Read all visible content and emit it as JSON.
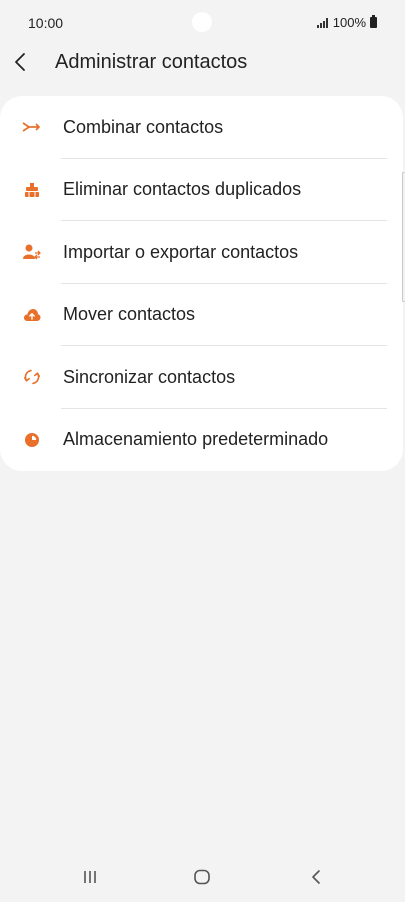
{
  "status_bar": {
    "time": "10:00",
    "battery": "100%"
  },
  "header": {
    "title": "Administrar contactos"
  },
  "menu": {
    "items": [
      {
        "label": "Combinar contactos",
        "icon": "merge-icon"
      },
      {
        "label": "Eliminar contactos duplicados",
        "icon": "duplicates-icon"
      },
      {
        "label": "Importar o exportar contactos",
        "icon": "import-export-icon"
      },
      {
        "label": "Mover contactos",
        "icon": "cloud-upload-icon"
      },
      {
        "label": "Sincronizar contactos",
        "icon": "sync-icon"
      },
      {
        "label": "Almacenamiento predeterminado",
        "icon": "storage-pie-icon"
      }
    ]
  },
  "colors": {
    "accent": "#e8702a",
    "background": "#f3f3f3",
    "card": "#ffffff",
    "text": "#222222"
  }
}
